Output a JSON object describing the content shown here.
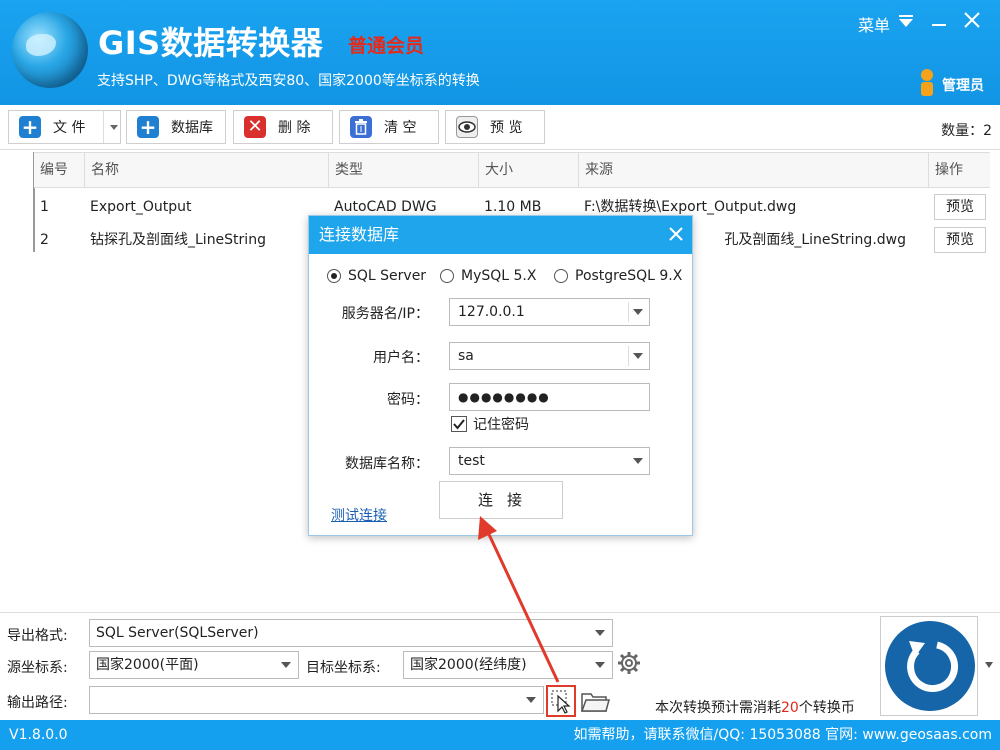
{
  "header": {
    "title": "GIS数据转换器",
    "member_badge": "普通会员",
    "subtitle": "支持SHP、DWG等格式及西安80、国家2000等坐标系的转换",
    "menu_label": "菜单",
    "admin_label": "管理员"
  },
  "toolbar": {
    "file_label": "文 件",
    "database_label": "数据库",
    "delete_label": "删 除",
    "clear_label": "清 空",
    "preview_label": "预 览",
    "count_label": "数量：2"
  },
  "table": {
    "columns": [
      "编号",
      "名称",
      "类型",
      "大小",
      "来源",
      "操作"
    ],
    "rows": [
      {
        "no": "1",
        "name": "Export_Output",
        "type": "AutoCAD DWG",
        "size": "1.10 MB",
        "source": "F:\\数据转换\\Export_Output.dwg",
        "action": "预览"
      },
      {
        "no": "2",
        "name": "钻探孔及剖面线_LineString",
        "type": "",
        "size": "",
        "source": "孔及剖面线_LineString.dwg",
        "action": "预览"
      }
    ]
  },
  "dialog": {
    "title": "连接数据库",
    "db_types": [
      "SQL Server",
      "MySQL 5.X",
      "PostgreSQL 9.X"
    ],
    "selected_db_type": "SQL Server",
    "server_label": "服务器名/IP：",
    "server_value": "127.0.0.1",
    "user_label": "用户名：",
    "user_value": "sa",
    "password_label": "密码：",
    "password_value": "●●●●●●●●",
    "remember_label": "记住密码",
    "remember_checked": true,
    "dbname_label": "数据库名称：",
    "dbname_value": "test",
    "test_link": "测试连接",
    "connect_button": "连接"
  },
  "bottom": {
    "export_format_label": "导出格式:",
    "export_format_value": "SQL Server(SQLServer)",
    "source_crs_label": "源坐标系:",
    "source_crs_value": "国家2000(平面)",
    "target_crs_label": "目标坐标系:",
    "target_crs_value": "国家2000(经纬度)",
    "output_path_label": "输出路径:",
    "output_path_value": "",
    "cost_prefix": "本次转换预计需消耗",
    "cost_value": "20",
    "cost_suffix": "个转换币"
  },
  "status": {
    "version": "V1.8.0.0",
    "help": "如需帮助，请联系微信/QQ:  15053088  官网:  www.geosaas.com"
  },
  "colors": {
    "header_blue": "#1aa3f0",
    "status_blue": "#14a0ee",
    "member_red": "#e52a1b",
    "annotation_red": "#e03a2a"
  }
}
